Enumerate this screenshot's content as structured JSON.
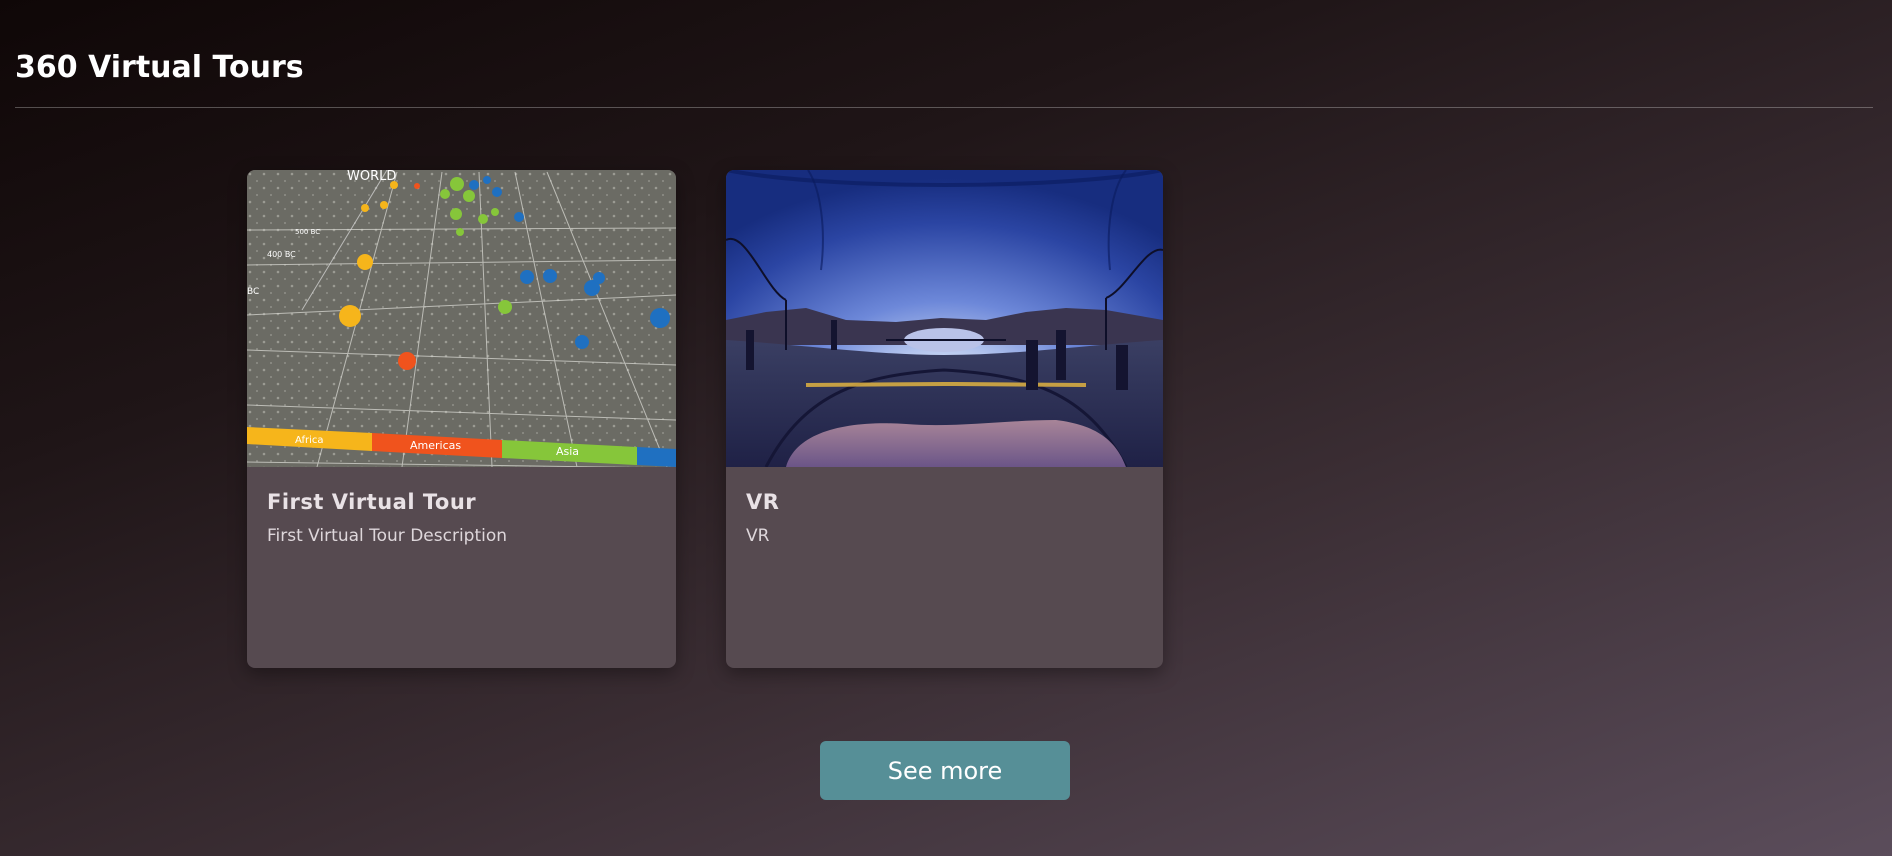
{
  "page": {
    "title": "360 Virtual Tours"
  },
  "tours": [
    {
      "title": "First Virtual Tour",
      "description": "First Virtual Tour Description",
      "thumbnail": {
        "kind": "3d-data-globe",
        "labels": {
          "heading": "WORLD",
          "year_500": "500 BC",
          "year_400": "400 BC",
          "year_cut": "BC"
        },
        "bands": [
          "Africa",
          "Americas",
          "Asia"
        ]
      }
    },
    {
      "title": "VR",
      "description": "VR",
      "thumbnail": {
        "kind": "360-panorama-bridge-dusk"
      }
    }
  ],
  "actions": {
    "see_more_label": "See more"
  },
  "colors": {
    "button_bg": "#568f97",
    "card_bg": "#564a50",
    "africa": "#f6b51b",
    "americas": "#f0531d",
    "asia": "#86c63a",
    "europe": "#1f70c1"
  }
}
